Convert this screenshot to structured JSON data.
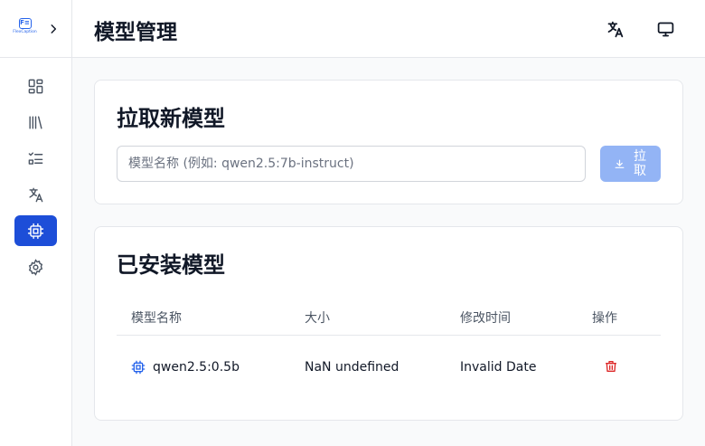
{
  "app": {
    "logo_text": "FlexCaption",
    "logo_mark": "F≡"
  },
  "header": {
    "title": "模型管理"
  },
  "sidebar": {
    "items": [
      {
        "name": "dashboard-icon",
        "active": false
      },
      {
        "name": "library-icon",
        "active": false
      },
      {
        "name": "tasks-icon",
        "active": false
      },
      {
        "name": "translate-icon",
        "active": false
      },
      {
        "name": "cpu-chip-icon",
        "active": true
      },
      {
        "name": "gear-icon",
        "active": false
      }
    ]
  },
  "pull_section": {
    "title": "拉取新模型",
    "placeholder": "模型名称 (例如: qwen2.5:7b-instruct)",
    "button_label": "拉取"
  },
  "models_section": {
    "title": "已安装模型",
    "columns": [
      "模型名称",
      "大小",
      "修改时间",
      "操作"
    ],
    "rows": [
      {
        "name": "qwen2.5:0.5b",
        "size": "NaN undefined",
        "modified": "Invalid Date"
      }
    ]
  },
  "colors": {
    "accent": "#1d4ed8",
    "danger": "#dc2626",
    "button_disabled": "#93b4f5"
  }
}
